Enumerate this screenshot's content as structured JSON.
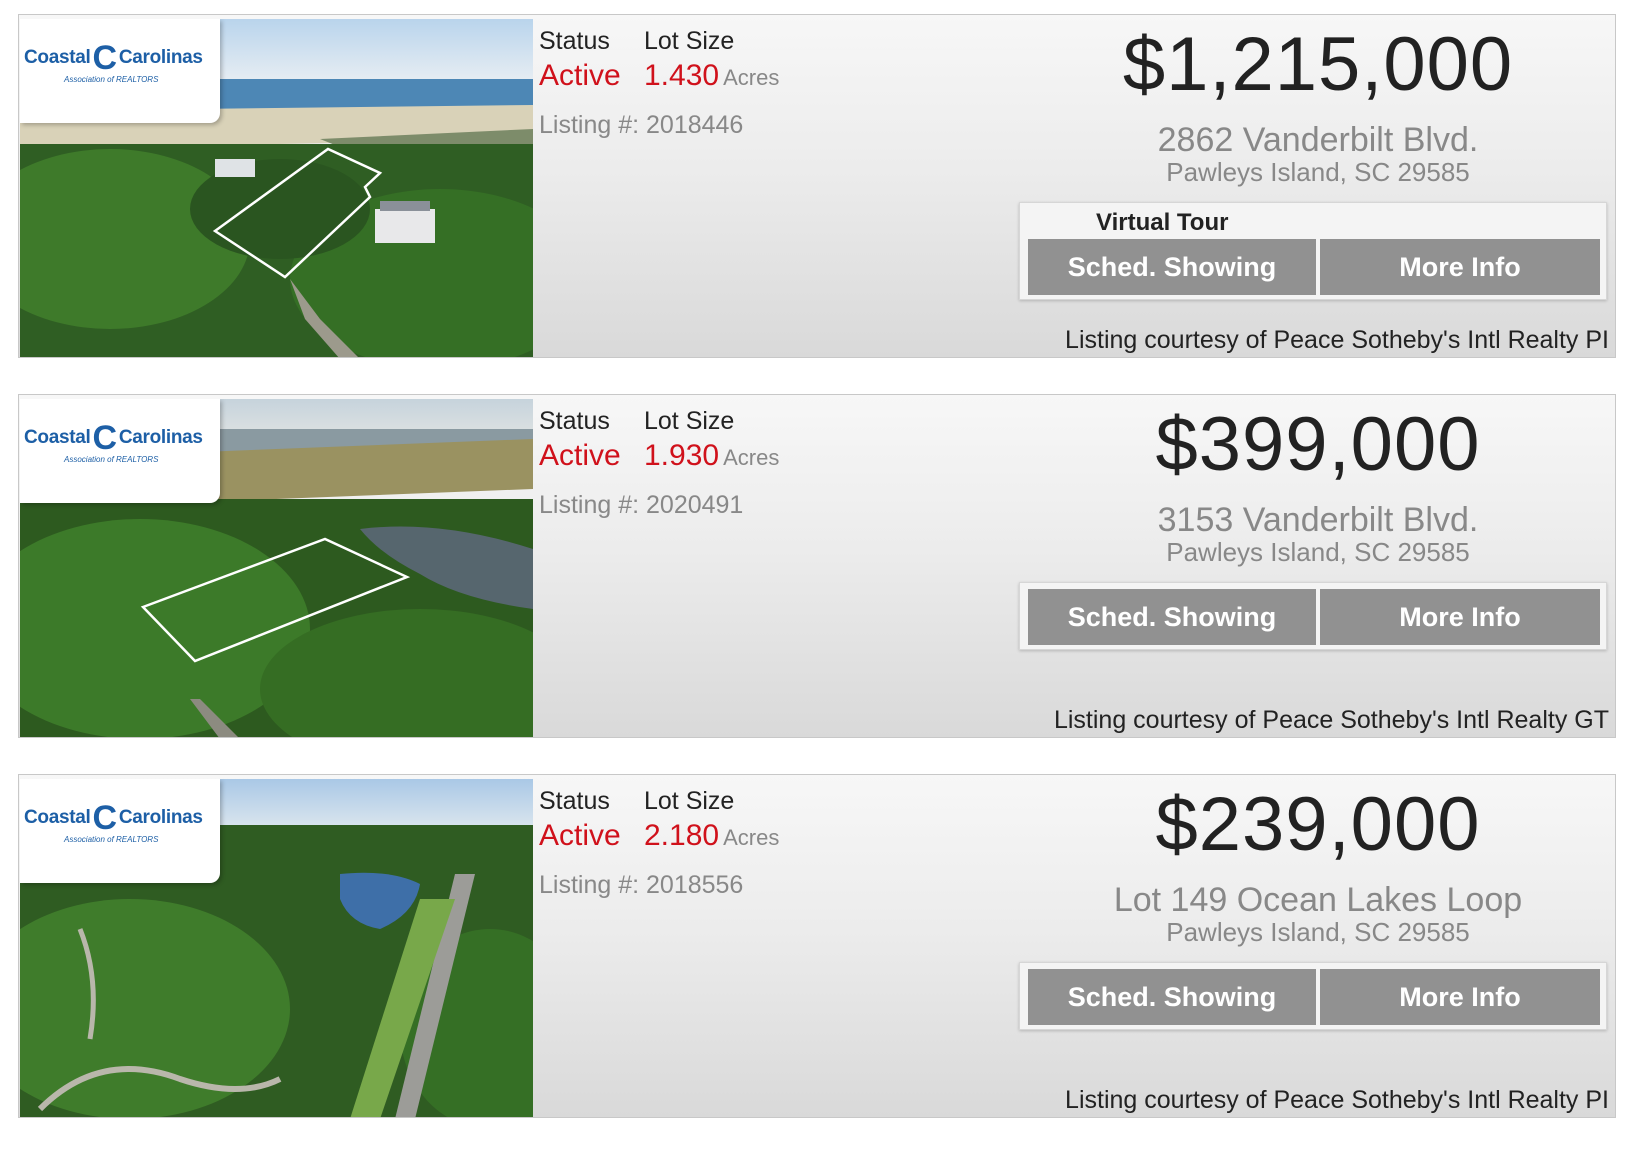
{
  "listings": [
    {
      "status_label": "Status",
      "status_value": "Active",
      "lot_label": "Lot Size",
      "lot_value": "1.430",
      "lot_unit": "Acres",
      "listing_number": "Listing #: 2018446",
      "price": "$1,215,000",
      "street": "2862 Vanderbilt Blvd.",
      "city": "Pawleys Island, SC 29585",
      "virtual_tour": "Virtual Tour",
      "sched_label": "Sched. Showing",
      "more_label": "More Info",
      "courtesy": "Listing courtesy of Peace Sotheby's Intl Realty PI"
    },
    {
      "status_label": "Status",
      "status_value": "Active",
      "lot_label": "Lot Size",
      "lot_value": "1.930",
      "lot_unit": "Acres",
      "listing_number": "Listing #: 2020491",
      "price": "$399,000",
      "street": "3153 Vanderbilt Blvd.",
      "city": "Pawleys Island, SC 29585",
      "sched_label": "Sched. Showing",
      "more_label": "More Info",
      "courtesy": "Listing courtesy of Peace Sotheby's Intl Realty GT"
    },
    {
      "status_label": "Status",
      "status_value": "Active",
      "lot_label": "Lot Size",
      "lot_value": "2.180",
      "lot_unit": "Acres",
      "listing_number": "Listing #: 2018556",
      "price": "$239,000",
      "street": "Lot 149 Ocean Lakes Loop",
      "city": "Pawleys Island, SC 29585",
      "sched_label": "Sched. Showing",
      "more_label": "More Info",
      "courtesy": "Listing courtesy of Peace Sotheby's Intl Realty PI"
    }
  ],
  "logo": {
    "part1": "Coastal",
    "part2": "Carolinas",
    "sub": "Association of REALTORS"
  },
  "colors": {
    "status_red": "#d0111b",
    "button_gray": "#919191",
    "logo_blue": "#1d5fa6"
  }
}
